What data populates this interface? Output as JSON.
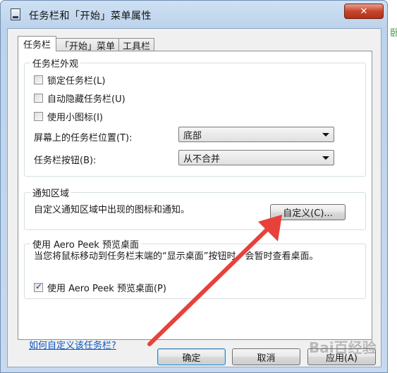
{
  "window": {
    "title": "任务栏和「开始」菜单属性",
    "close_label": "✕"
  },
  "tabs": [
    {
      "label": "任务栏"
    },
    {
      "label": "「开始」菜单"
    },
    {
      "label": "工具栏"
    }
  ],
  "appearance": {
    "title": "任务栏外观",
    "lock_label": "锁定任务栏(L)",
    "autohide_label": "自动隐藏任务栏(U)",
    "small_icons_label": "使用小图标(I)",
    "location_label": "屏幕上的任务栏位置(T):",
    "location_value": "底部",
    "buttons_label": "任务栏按钮(B):",
    "buttons_value": "从不合并"
  },
  "notification": {
    "title": "通知区域",
    "description": "自定义通知区域中出现的图标和通知。",
    "customize_button": "自定义(C)..."
  },
  "aero_peek": {
    "title": "使用 Aero Peek 预览桌面",
    "description": "当您将鼠标移动到任务栏末端的“显示桌面”按钮时，会暂时查看桌面。",
    "checkbox_label": "使用 Aero Peek 预览桌面(P)"
  },
  "help_link": "如何自定义该任务栏?",
  "buttons": {
    "ok": "确定",
    "cancel": "取消",
    "apply": "应用(A)"
  },
  "side_text": "卧",
  "watermark": "Bai百经验",
  "colors": {
    "arrow": "#e8413b",
    "link": "#0b57c2"
  }
}
